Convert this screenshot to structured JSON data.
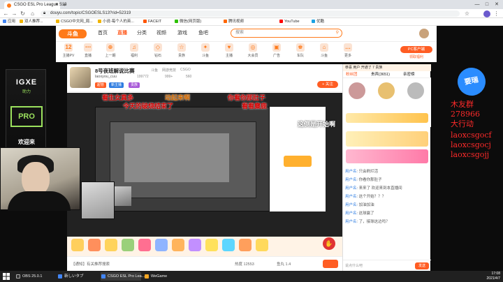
{
  "browser": {
    "tabs": [
      {
        "title": "CSGO ESL Pro League S13"
      }
    ],
    "url": "douyu.com/topic/CSGOESLS13?rid=52319",
    "bookmarks": [
      "应用",
      "双人推荐...",
      "CSGO中文网_局...",
      "小说-每个人的英...",
      "FACEIT",
      "微信(网页版)",
      "腾讯视频",
      "YouTube",
      "优酷"
    ],
    "window_controls": [
      "—",
      "□",
      "✕"
    ]
  },
  "site": {
    "logo": "斗鱼",
    "nav": [
      "首页",
      "直播",
      "分类",
      "视频",
      "游戏",
      "鱼吧"
    ],
    "active_nav": "直播",
    "search_placeholder": "搜索",
    "categories": [
      {
        "label": "12",
        "sub": "主播PV"
      },
      {
        "label": "⋯",
        "sub": "直播"
      },
      {
        "label": "⊕",
        "sub": "上一期"
      },
      {
        "label": "♫",
        "sub": "福利"
      },
      {
        "label": "◇",
        "sub": "钻石"
      },
      {
        "label": "☆",
        "sub": "贵族"
      },
      {
        "label": "✦",
        "sub": "斗鱼"
      },
      {
        "label": "♥",
        "sub": "主播"
      },
      {
        "label": "◎",
        "sub": "大会员"
      },
      {
        "label": "▣",
        "sub": "广告"
      },
      {
        "label": "♚",
        "sub": "车队"
      },
      {
        "label": "⌂",
        "sub": "斗鱼"
      },
      {
        "label": "…",
        "sub": "更多"
      }
    ],
    "pc_button": "PC客户端",
    "gift_label": "领取福利"
  },
  "left_banner": {
    "brand": "IGXE",
    "subtitle": "助力",
    "pro_label": "PRO",
    "bottom_text": "欢迎来"
  },
  "right_banner": {
    "bubble": "要瑞",
    "lines": [
      "木友群",
      "278966",
      "大行动",
      "laoxcsgocf",
      "laoxcsgocj",
      "laoxcsgojj"
    ]
  },
  "room": {
    "title": "8号夜班解说比赛",
    "meta": [
      "斗鱼",
      "网游竞技",
      "CSGO"
    ],
    "anchor": "laoxyou_cuu",
    "stats": [
      "199772",
      "999+",
      "560"
    ],
    "tags": [
      "超管",
      "新主播",
      "贵族"
    ],
    "follow": "+ 关注",
    "danmu": [
      {
        "text": "看生女真多",
        "color": "#d40000"
      },
      {
        "text": "动起来啊",
        "color": "#d46a00"
      },
      {
        "text": "你看你那肚子",
        "color": "#d40000"
      },
      {
        "text": "今天的破烧结束了",
        "color": "#d40000"
      },
      {
        "text": "看看麋鹿",
        "color": "#d40000"
      },
      {
        "text": "这倒是开始啊",
        "color": "#ffffff"
      }
    ],
    "bottom_info": [
      "热度 12553",
      "鱼丸 1.4"
    ],
    "bottom_left": "【通知】有关推荐搜索"
  },
  "chat": {
    "top_notice": "恭喜 用户 开通了 7 贵族",
    "tabs": [
      "粉丝团",
      "贵宾(3651)",
      "亲密榜"
    ],
    "messages": [
      {
        "user": "用户名",
        "text": "只会刷烂活"
      },
      {
        "user": "用户名",
        "text": "你看你那肚子"
      },
      {
        "user": "用户名",
        "text": "来来了 欢迎来到本直播间"
      },
      {
        "user": "用户名",
        "text": "这个开始？？？"
      },
      {
        "user": "用户名",
        "text": "加油加油"
      },
      {
        "user": "用户名",
        "text": "这球赢了"
      },
      {
        "user": "用户名",
        "text": "了，接球这边吗？"
      }
    ],
    "input_placeholder": "说点什么吧",
    "send": "发送"
  },
  "taskbar": {
    "items": [
      "OBS 25.0.1",
      "新しいタブ",
      "CSGO ESL Pro Lea...",
      "WeGame"
    ],
    "time": "17:08",
    "date": "2021/4/7"
  }
}
